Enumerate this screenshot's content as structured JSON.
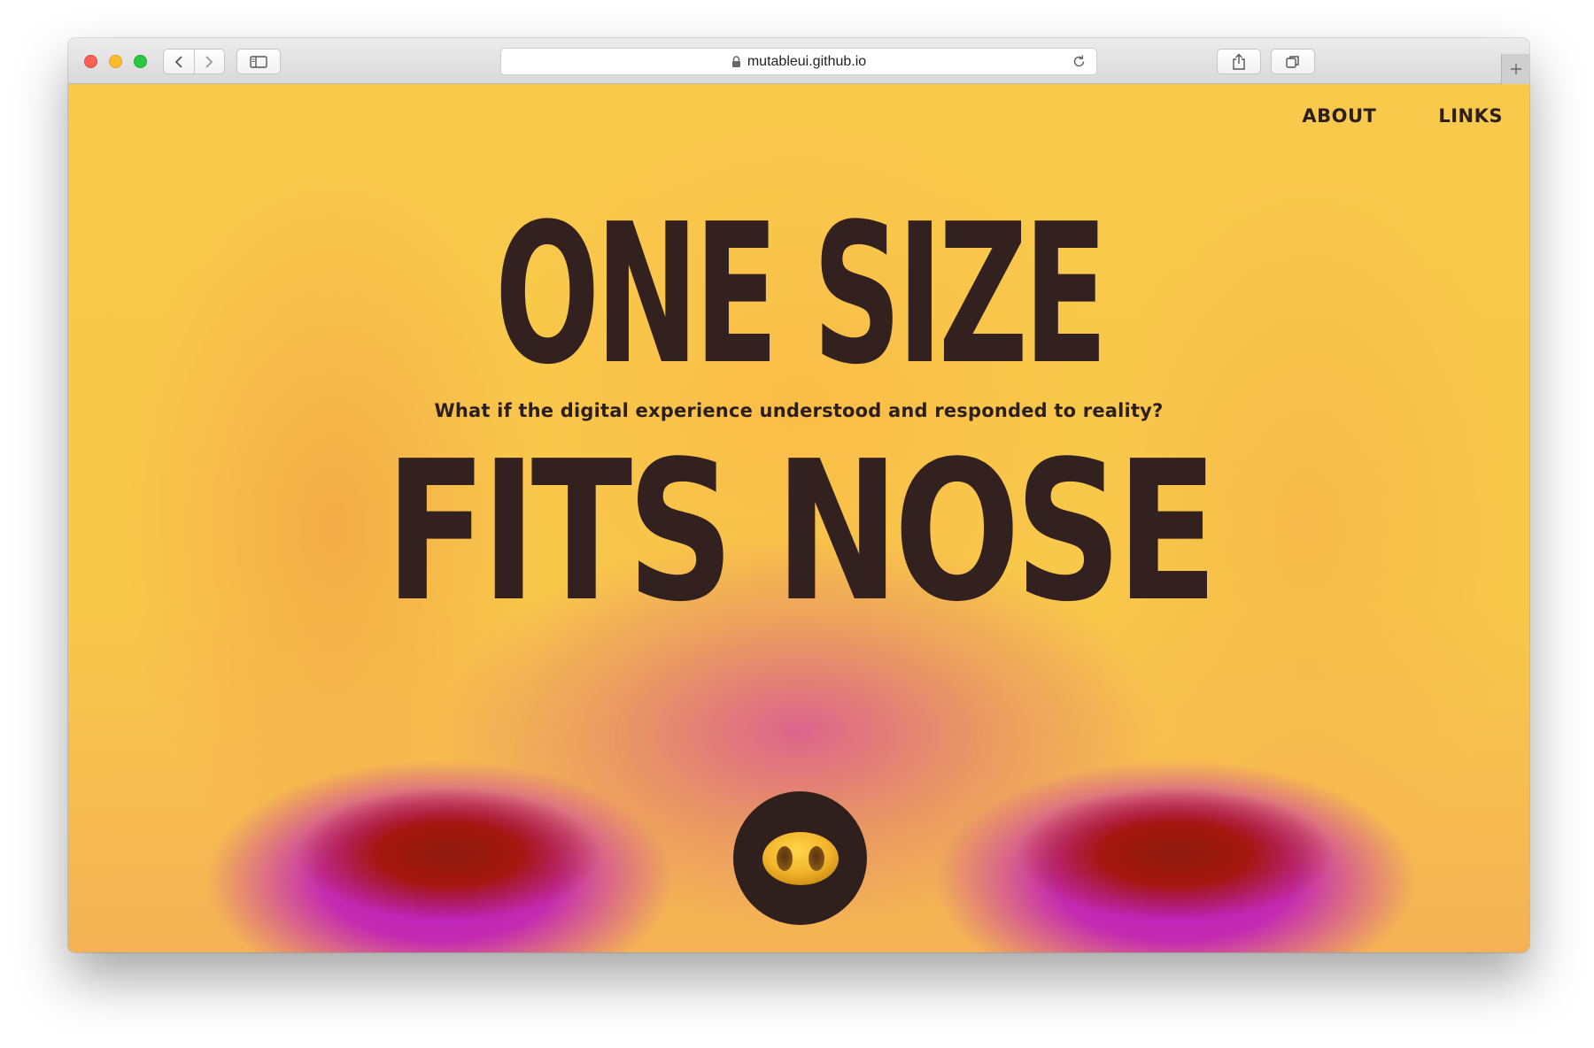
{
  "browser": {
    "url": "mutableui.github.io",
    "icons": {
      "back": "chevron-left-icon",
      "forward": "chevron-right-icon",
      "sidebar": "sidebar-icon",
      "lock": "lock-icon",
      "reload": "reload-icon",
      "share": "share-icon",
      "tabs": "tabs-overview-icon",
      "new_tab": "plus-icon"
    }
  },
  "nav": {
    "items": [
      {
        "label": "ABOUT"
      },
      {
        "label": "LINKS"
      }
    ]
  },
  "hero": {
    "line1": "ONE SIZE",
    "tagline": "What if the digital experience understood and responded to reality?",
    "line2": "FITS NOSE"
  },
  "nose_button": {
    "icon": "pig-nose-icon"
  },
  "colors": {
    "background_yellow": "#f9c94c",
    "text_dark": "#33211f",
    "button_dark": "#2f201d",
    "nostril_purple": "#b11bc5",
    "nostril_red": "#8e1a0d"
  }
}
